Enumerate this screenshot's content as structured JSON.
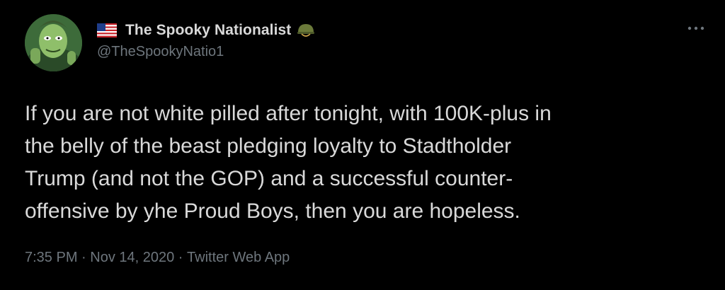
{
  "author": {
    "display_name": "The Spooky Nationalist",
    "handle": "@TheSpookyNatio1",
    "flag_icon": "us-flag-icon",
    "badge_icon": "military-helmet-icon"
  },
  "tweet": {
    "text": "If you are not white pilled after tonight, with 100K-plus in\nthe belly of the beast pledging loyalty to Stadtholder\nTrump (and not the GOP) and a successful counter-\noffensive by yhe Proud Boys, then you are hopeless.",
    "time": "7:35 PM",
    "date": "Nov 14, 2020",
    "source": "Twitter Web App",
    "separator": " · "
  },
  "colors": {
    "background": "#000000",
    "primary_text": "#d9d9d9",
    "secondary_text": "#6e767d"
  },
  "menu": {
    "more_icon": "more-horizontal-icon"
  }
}
